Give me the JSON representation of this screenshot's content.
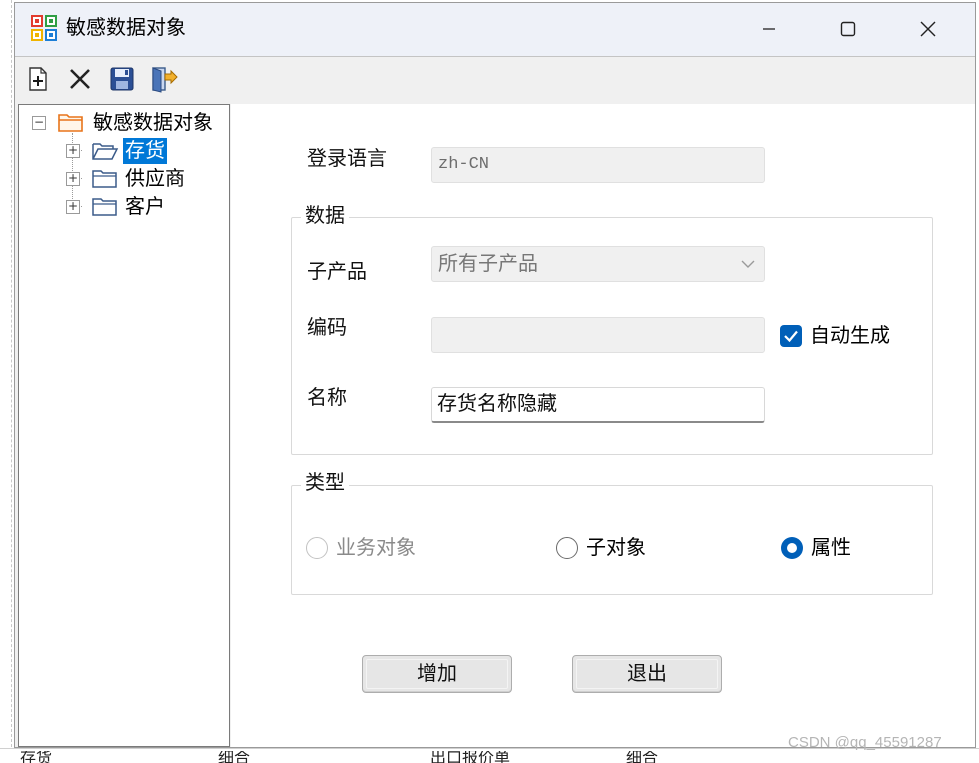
{
  "window": {
    "title": "敏感数据对象",
    "controls": [
      "minimize",
      "maximize",
      "close"
    ]
  },
  "toolbar": {
    "buttons": [
      {
        "icon": "new-document-icon"
      },
      {
        "icon": "delete-x-icon"
      },
      {
        "icon": "save-disk-icon"
      },
      {
        "icon": "exit-door-icon"
      }
    ]
  },
  "tree": {
    "root": {
      "label": "敏感数据对象",
      "expanded": true
    },
    "children": [
      {
        "label": "存货",
        "selected": true,
        "open_folder": true
      },
      {
        "label": "供应商",
        "selected": false
      },
      {
        "label": "客户",
        "selected": false
      }
    ]
  },
  "form": {
    "login_language": {
      "label": "登录语言",
      "value": "zh-CN"
    },
    "data_group": {
      "title": "数据",
      "sub_product": {
        "label": "子产品",
        "value": "所有子产品"
      },
      "code": {
        "label": "编码",
        "value": "",
        "auto_generate_label": "自动生成",
        "auto_generate_checked": true
      },
      "name": {
        "label": "名称",
        "value": "存货名称隐藏"
      }
    },
    "type_group": {
      "title": "类型",
      "options": [
        {
          "label": "业务对象",
          "checked": false,
          "disabled": true
        },
        {
          "label": "子对象",
          "checked": false,
          "disabled": false
        },
        {
          "label": "属性",
          "checked": true,
          "disabled": false
        }
      ]
    }
  },
  "buttons": {
    "add": "增加",
    "exit": "退出"
  },
  "background": {
    "bottom_cells": [
      "存货",
      "细合",
      "出口报价单",
      "细合"
    ]
  },
  "watermark": "CSDN @qq_45591287",
  "colors": {
    "accent": "#005fb8",
    "selection": "#0078d7",
    "folder_outline": "#3b5b8a",
    "root_folder_orange": "#e8741a"
  }
}
